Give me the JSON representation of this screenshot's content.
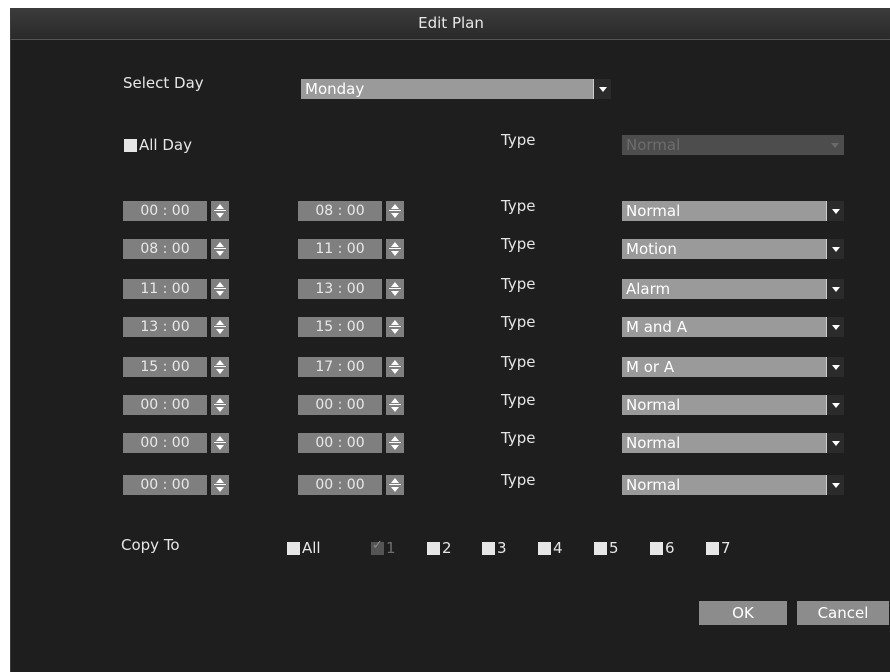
{
  "dialog": {
    "title": "Edit Plan"
  },
  "select_day": {
    "label": "Select Day",
    "value": "Monday"
  },
  "all_day": {
    "label": "All Day",
    "type_label": "Type",
    "type_value": "Normal"
  },
  "schedule": [
    {
      "start": "00 : 00",
      "end": "08 : 00",
      "type_label": "Type",
      "type": "Normal"
    },
    {
      "start": "08 : 00",
      "end": "11 : 00",
      "type_label": "Type",
      "type": "Motion"
    },
    {
      "start": "11 : 00",
      "end": "13 : 00",
      "type_label": "Type",
      "type": "Alarm"
    },
    {
      "start": "13 : 00",
      "end": "15 : 00",
      "type_label": "Type",
      "type": "M and A"
    },
    {
      "start": "15 : 00",
      "end": "17 : 00",
      "type_label": "Type",
      "type": "M or A"
    },
    {
      "start": "00 : 00",
      "end": "00 : 00",
      "type_label": "Type",
      "type": "Normal"
    },
    {
      "start": "00 : 00",
      "end": "00 : 00",
      "type_label": "Type",
      "type": "Normal"
    },
    {
      "start": "00 : 00",
      "end": "00 : 00",
      "type_label": "Type",
      "type": "Normal"
    }
  ],
  "copy_to": {
    "label": "Copy To",
    "options": [
      {
        "label": "All",
        "checked": false,
        "disabled": false
      },
      {
        "label": "1",
        "checked": true,
        "disabled": true
      },
      {
        "label": "2",
        "checked": false,
        "disabled": false
      },
      {
        "label": "3",
        "checked": false,
        "disabled": false
      },
      {
        "label": "4",
        "checked": false,
        "disabled": false
      },
      {
        "label": "5",
        "checked": false,
        "disabled": false
      },
      {
        "label": "6",
        "checked": false,
        "disabled": false
      },
      {
        "label": "7",
        "checked": false,
        "disabled": false
      }
    ]
  },
  "buttons": {
    "ok": "OK",
    "cancel": "Cancel"
  }
}
